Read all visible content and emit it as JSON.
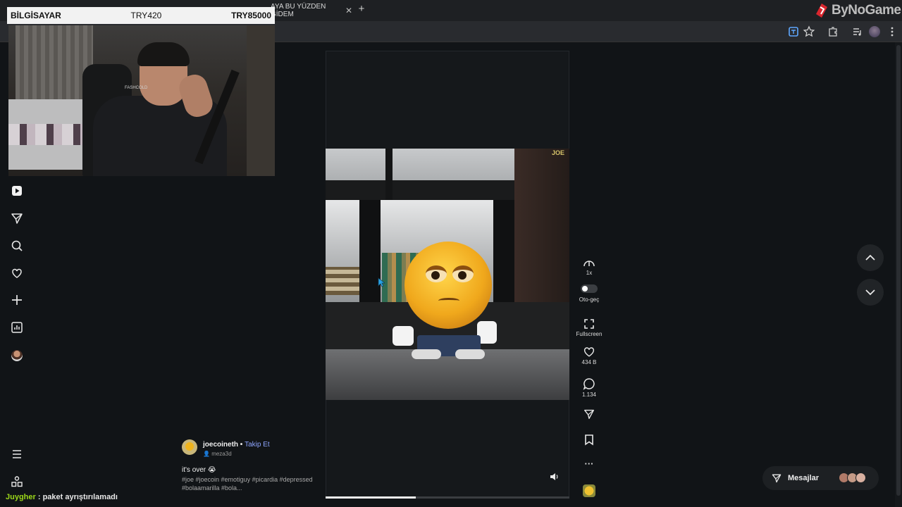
{
  "overlay": {
    "label": "BİLGİSAYAR",
    "price_low": "TRY420",
    "price_high": "TRY85000"
  },
  "browser": {
    "tab_title": "AYA BU YÜZDEN GİDEM",
    "tab_close": "✕",
    "new_tab": "+",
    "watermark": "ByNoGame"
  },
  "webcam": {
    "shirt_text": "FASHCOLD"
  },
  "video": {
    "watermark": "JOE",
    "progress": 0.37
  },
  "actions": {
    "speed_label": "1x",
    "autoplay_label": "Oto-geç",
    "fullscreen_label": "Fullscreen",
    "likes": "434 B",
    "comments": "1.134",
    "more": "···"
  },
  "caption": {
    "author": "joecoineth",
    "separator": " • ",
    "follow": "Takip Et",
    "handle": "meza3d",
    "text": "it's over 😭",
    "hashtags": "#joe #joecoin #emotiguy #picardia #depressed #bolaamarilla #bola..."
  },
  "chat": {
    "user": "Juygher",
    "message": " : paket ayrıştırılamadı"
  },
  "messages": {
    "label": "Mesajlar"
  },
  "icons": {
    "nav": [
      "play-icon",
      "send-icon",
      "search-icon",
      "heart-icon",
      "plus-icon",
      "analytics-icon",
      "profile-avatar"
    ],
    "bottom": [
      "menu-icon",
      "apps-icon"
    ]
  },
  "colors": {
    "background": "#111417",
    "follow": "#8ea5ff",
    "chat_user": "#9cd81a",
    "emoji_face": "#f0a81c"
  }
}
